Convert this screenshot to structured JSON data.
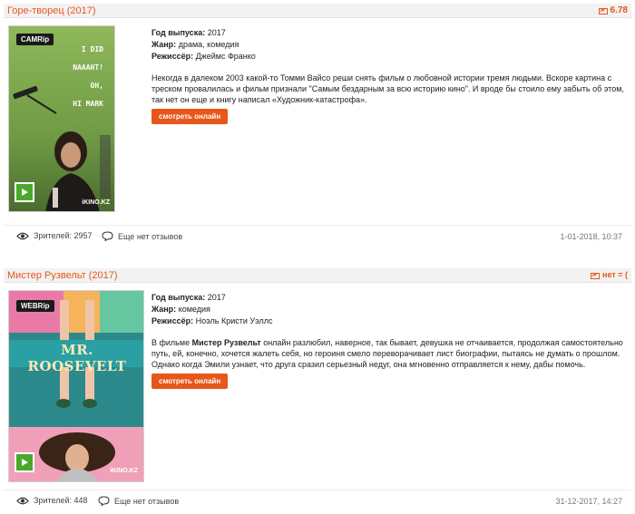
{
  "movies": [
    {
      "title": "Горе-творец (2017)",
      "rating": "6.78",
      "quality": "CAMRip",
      "site": "iKINO.KZ",
      "poster_text": [
        "I DID",
        "NAAAHT!",
        "OH,",
        "HI MARK"
      ],
      "year_label": "Год выпуска:",
      "year": "2017",
      "genre_label": "Жанр:",
      "genre": "драма, комедия",
      "director_label": "Режиссёр:",
      "director": "Джеймс Франко",
      "description": "Некогда в далеком 2003 какой-то Томми Вайсо реши снять фильм о любовной истории тремя людьми. Вскоре картина с треском провалилась и фильм признали \"Самым бездарным за всю историю кино\". И вроде бы стоило ему забыть об этом, так нет он еще и книгу написал «Художник-катастрофа».",
      "watch_label": "смотреть онлайн",
      "viewers": "Зрителей: 2957",
      "reviews": "Еще нет отзывов",
      "date": "1-01-2018, 10:37"
    },
    {
      "title": "Мистер Рузвельт (2017)",
      "rating": "нет = (",
      "quality": "WEBRip",
      "site": "iKINO.KZ",
      "poster_title": "MR. ROOSEVELT",
      "year_label": "Год выпуска:",
      "year": "2017",
      "genre_label": "Жанр:",
      "genre": "комедия",
      "director_label": "Режиссёр:",
      "director": "Ноэль Кристи Уэллс",
      "desc_prefix": "В фильме ",
      "desc_bold": "Мистер Рузвельт",
      "desc_rest": " онлайн разлюбил, наверное, так бывает, девушка не отчаивается, продолжая самостоятельно путь, ей, конечно, хочется жалеть себя, но героиня смело переворачивает лист биографии, пытаясь не думать о прошлом. Однако когда Эмили узнает, что друга сразил серьезный недуг, она мгновенно отправляется к нему, дабы помочь.",
      "watch_label": "смотреть онлайн",
      "viewers": "Зрителей: 448",
      "reviews": "Еще нет отзывов",
      "date": "31-12-2017, 14:27"
    }
  ],
  "colors": {
    "accent": "#e8561a",
    "header_bg": "#f2f2f2"
  },
  "icons": {
    "rating": "rating-icon",
    "views": "eye-icon",
    "reviews": "comment-icon",
    "play": "play-icon"
  }
}
